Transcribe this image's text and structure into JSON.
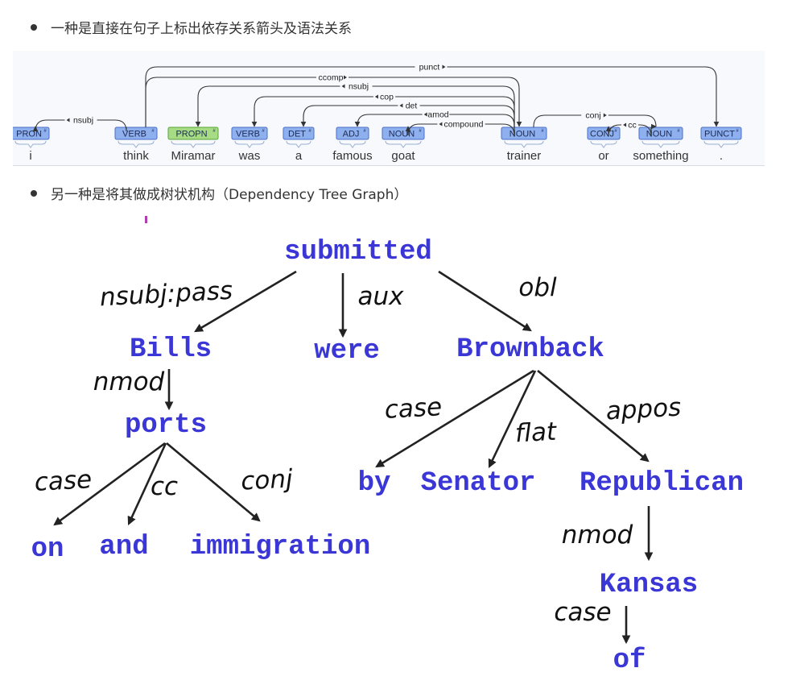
{
  "bullets": [
    "一种是直接在句子上标出依存关系箭头及语法关系",
    "另一种是将其做成树状机构（Dependency Tree Graph）"
  ],
  "colors": {
    "tag_fill": "#8fb0ee",
    "tag_stroke": "#4a70c8",
    "propn_fill": "#a7dc85",
    "propn_stroke": "#5aa43a",
    "tree_word": "#3b37d6",
    "arrow": "#222222"
  },
  "dependency_sentence": {
    "tokens": [
      {
        "word": "i",
        "tag": "PRON"
      },
      {
        "word": "think",
        "tag": "VERB"
      },
      {
        "word": "Miramar",
        "tag": "PROPN"
      },
      {
        "word": "was",
        "tag": "VERB"
      },
      {
        "word": "a",
        "tag": "DET"
      },
      {
        "word": "famous",
        "tag": "ADJ"
      },
      {
        "word": "goat",
        "tag": "NOUN"
      },
      {
        "word": "trainer",
        "tag": "NOUN"
      },
      {
        "word": "or",
        "tag": "CONJ"
      },
      {
        "word": "something",
        "tag": "NOUN"
      },
      {
        "word": ".",
        "tag": "PUNCT"
      }
    ],
    "arcs": [
      {
        "head": 1,
        "dep": 0,
        "label": "nsubj"
      },
      {
        "head": 1,
        "dep": 10,
        "label": "punct"
      },
      {
        "head": 1,
        "dep": 7,
        "label": "ccomp"
      },
      {
        "head": 7,
        "dep": 2,
        "label": "nsubj"
      },
      {
        "head": 7,
        "dep": 3,
        "label": "cop"
      },
      {
        "head": 7,
        "dep": 4,
        "label": "det"
      },
      {
        "head": 7,
        "dep": 5,
        "label": "amod"
      },
      {
        "head": 7,
        "dep": 6,
        "label": "compound"
      },
      {
        "head": 7,
        "dep": 9,
        "label": "conj"
      },
      {
        "head": 9,
        "dep": 8,
        "label": "cc"
      }
    ]
  },
  "tree": {
    "words": [
      {
        "id": "submitted",
        "text": "submitted"
      },
      {
        "id": "bills",
        "text": "Bills"
      },
      {
        "id": "were",
        "text": "were"
      },
      {
        "id": "brownback",
        "text": "Brownback"
      },
      {
        "id": "ports",
        "text": "ports"
      },
      {
        "id": "on",
        "text": "on"
      },
      {
        "id": "and",
        "text": "and"
      },
      {
        "id": "immigration",
        "text": "immigration"
      },
      {
        "id": "by",
        "text": "by"
      },
      {
        "id": "senator",
        "text": "Senator"
      },
      {
        "id": "republican",
        "text": "Republican"
      },
      {
        "id": "kansas",
        "text": "Kansas"
      },
      {
        "id": "of",
        "text": "of"
      }
    ],
    "edges": [
      {
        "from": "submitted",
        "to": "bills",
        "label": "nsubj:pass"
      },
      {
        "from": "submitted",
        "to": "were",
        "label": "aux"
      },
      {
        "from": "submitted",
        "to": "brownback",
        "label": "obl"
      },
      {
        "from": "bills",
        "to": "ports",
        "label": "nmod"
      },
      {
        "from": "ports",
        "to": "on",
        "label": "case"
      },
      {
        "from": "ports",
        "to": "and",
        "label": "cc"
      },
      {
        "from": "ports",
        "to": "immigration",
        "label": "conj"
      },
      {
        "from": "brownback",
        "to": "by",
        "label": "case"
      },
      {
        "from": "brownback",
        "to": "senator",
        "label": "flat"
      },
      {
        "from": "brownback",
        "to": "republican",
        "label": "appos"
      },
      {
        "from": "republican",
        "to": "kansas",
        "label": "nmod"
      },
      {
        "from": "kansas",
        "to": "of",
        "label": "case"
      }
    ]
  }
}
